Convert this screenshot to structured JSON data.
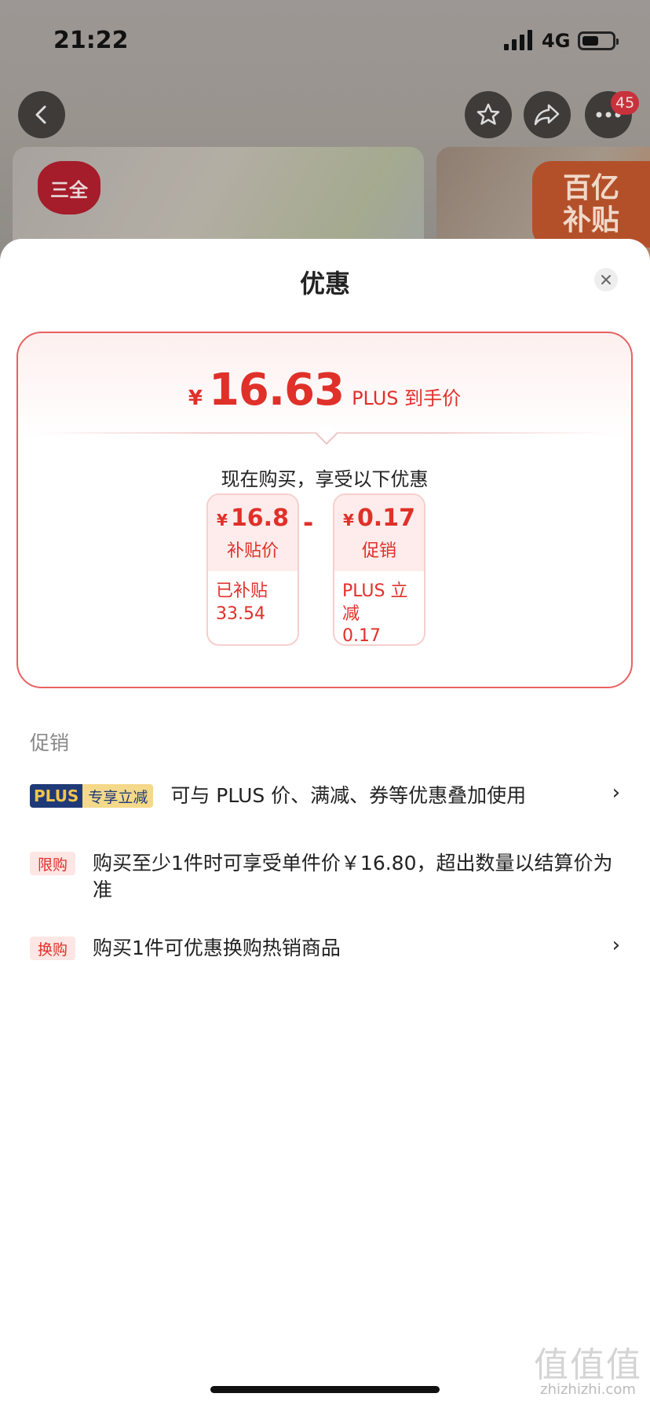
{
  "status_bar": {
    "time": "21:22",
    "network": "4G"
  },
  "header": {
    "badge_count": "45"
  },
  "product_images": {
    "brand_logo_text": "三全",
    "subsidy_line1": "百亿",
    "subsidy_line2": "补贴"
  },
  "sheet": {
    "title": "优惠",
    "price": {
      "symbol": "¥",
      "value": "16.63",
      "label": "PLUS 到手价"
    },
    "enjoy_text": "现在购买，享受以下优惠",
    "coupons": [
      {
        "symbol": "¥",
        "value": "16.8",
        "name": "补贴价",
        "detail_line1": "已补贴",
        "detail_line2": "33.54"
      },
      {
        "symbol": "¥",
        "value": "0.17",
        "name": "促销",
        "detail_line1": "PLUS 立减",
        "detail_line2": "0.17"
      }
    ],
    "operator": "-",
    "section_title": "促销",
    "promos": [
      {
        "tag_part1": "PLUS",
        "tag_part2": "专享立减",
        "text": "可与 PLUS 价、满减、券等优惠叠加使用",
        "chevron": "›"
      },
      {
        "tag": "限购",
        "text": "购买至少1件时可享受单件价￥16.80，超出数量以结算价为准"
      },
      {
        "tag": "换购",
        "text": "购买1件可优惠换购热销商品",
        "chevron": "›"
      }
    ]
  },
  "watermark": {
    "mark": "值值值",
    "site": "zhizhizhi.com"
  },
  "colors": {
    "accent_red": "#e0302a",
    "plus_navy": "#1f3a78",
    "plus_gold": "#f4d98a"
  }
}
